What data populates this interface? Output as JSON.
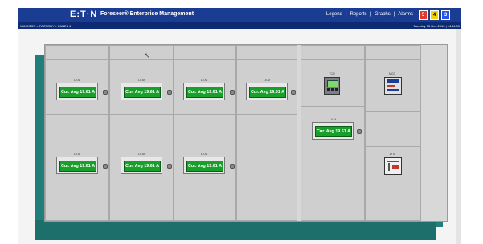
{
  "header": {
    "logo": "E:T·N",
    "app_title": "Foreseer® Enterprise Management",
    "nav": [
      "Legend",
      "Reports",
      "Graphs"
    ],
    "separators": "|",
    "alarms_label": "Alarms",
    "alarm_counts": [
      {
        "value": "5",
        "color": "#e23a2a"
      },
      {
        "value": "4",
        "color": "#f2d200"
      },
      {
        "value": "3",
        "color": "#2a52e6"
      }
    ]
  },
  "subheader": {
    "breadcrumb": "WINDSOR > FACTORY > PANEL 4",
    "datetime": "Tuesday 13 Dec 2016 | 14:11:50"
  },
  "meters": [
    {
      "label": "LV-M",
      "value": "Cur. Avg 19.61 A"
    },
    {
      "label": "LV-M",
      "value": "Cur. Avg 19.61 A"
    },
    {
      "label": "LV-M",
      "value": "Cur. Avg 19.61 A"
    },
    {
      "label": "LV-M",
      "value": "Cur. Avg 19.61 A"
    },
    {
      "label": "LV-M",
      "value": "Cur. Avg 19.61 A"
    },
    {
      "label": "LV-M",
      "value": "Cur. Avg 19.61 A"
    },
    {
      "label": "LV-M",
      "value": "Cur. Avg 19.61 A"
    },
    {
      "label": "LV-M",
      "value": "Cur. Avg 19.61 A"
    }
  ],
  "devices": [
    {
      "label": "TCU",
      "icon": "relay-icon"
    },
    {
      "label": "MCD",
      "icon": "meter-panel-icon"
    },
    {
      "label": "ATS",
      "icon": "switch-icon"
    }
  ]
}
